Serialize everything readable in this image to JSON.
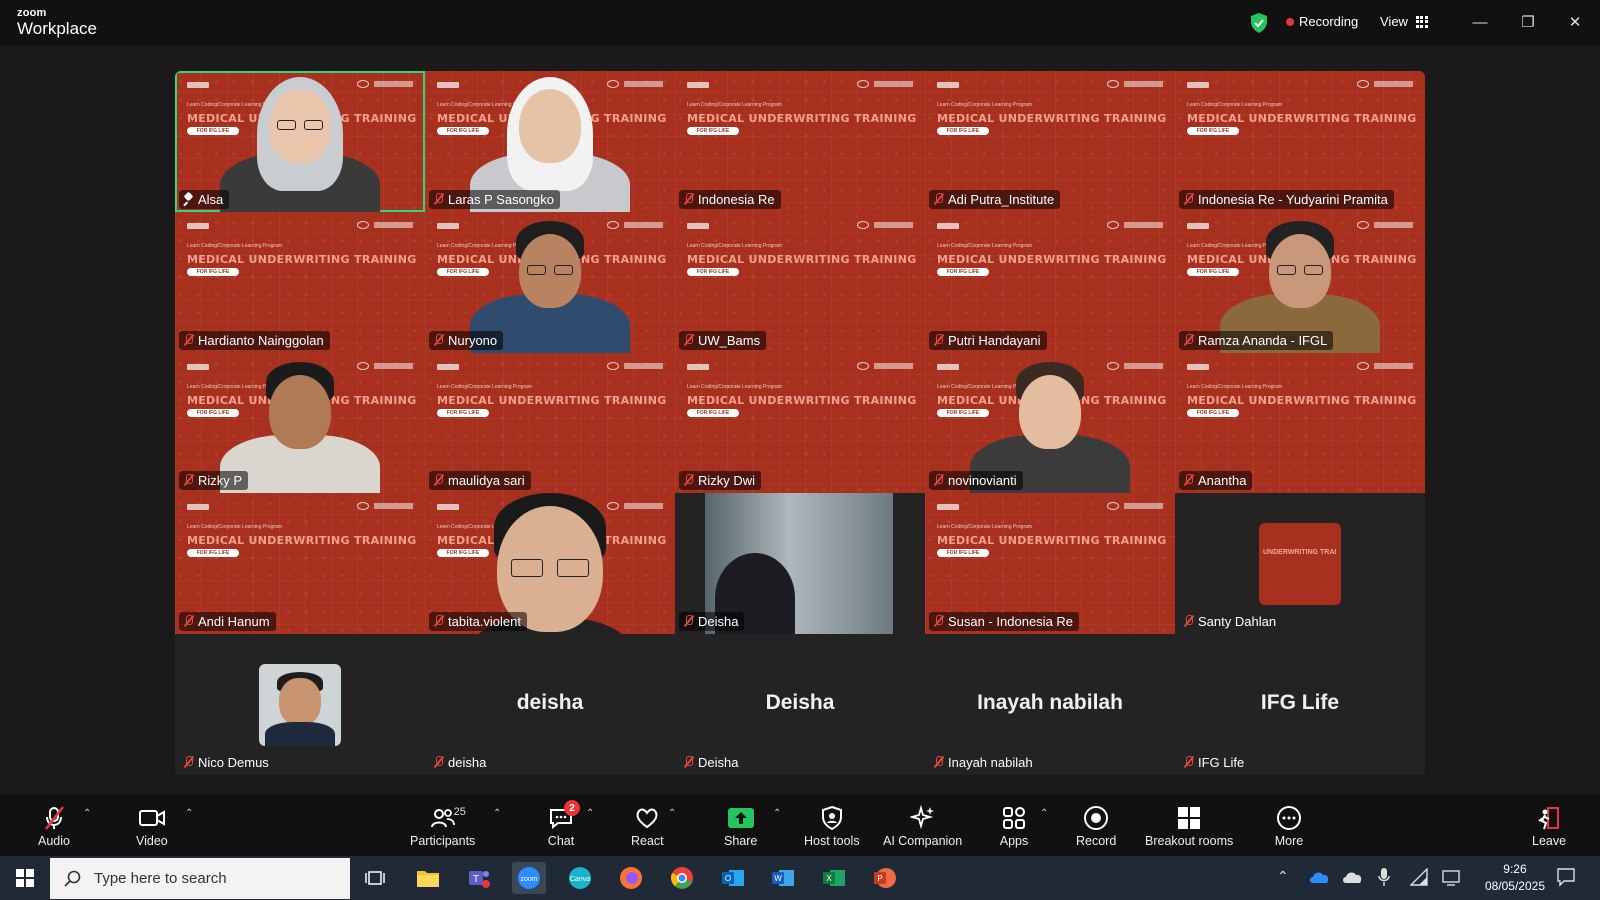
{
  "app": {
    "brand_top": "zoom",
    "brand_bottom": "Workplace"
  },
  "titlebar": {
    "recording_label": "Recording",
    "view_label": "View"
  },
  "tiles": [
    {
      "name": "Alsa",
      "kind": "slide-person",
      "icon": "pin-icon",
      "active": true
    },
    {
      "name": "Laras P Sasongko",
      "kind": "slide-person"
    },
    {
      "name": "Indonesia Re",
      "kind": "slide"
    },
    {
      "name": "Adi Putra_Institute",
      "kind": "slide"
    },
    {
      "name": "Indonesia Re - Yudyarini Pramita",
      "kind": "slide"
    },
    {
      "name": "Hardianto Nainggolan",
      "kind": "slide"
    },
    {
      "name": "Nuryono",
      "kind": "slide-person"
    },
    {
      "name": "UW_Bams",
      "kind": "slide"
    },
    {
      "name": "Putri Handayani",
      "kind": "slide"
    },
    {
      "name": "Ramza Ananda - IFGL",
      "kind": "slide-person"
    },
    {
      "name": "Rizky P",
      "kind": "slide-person"
    },
    {
      "name": "maulidya sari",
      "kind": "slide"
    },
    {
      "name": "Rizky Dwi",
      "kind": "slide"
    },
    {
      "name": "novinovianti",
      "kind": "slide-person"
    },
    {
      "name": "Anantha",
      "kind": "slide"
    },
    {
      "name": "Andi Hanum",
      "kind": "slide"
    },
    {
      "name": "tabita.violent",
      "kind": "slide-person"
    },
    {
      "name": "Deisha",
      "kind": "photo"
    },
    {
      "name": "Susan - Indonesia Re",
      "kind": "slide"
    },
    {
      "name": "Santy Dahlan",
      "kind": "mini-slide"
    },
    {
      "name": "Nico Demus",
      "kind": "avatar"
    },
    {
      "name": "deisha",
      "kind": "name-only",
      "display": "deisha"
    },
    {
      "name": "Deisha",
      "kind": "name-only",
      "display": "Deisha"
    },
    {
      "name": "Inayah nabilah",
      "kind": "name-only",
      "display": "Inayah nabilah"
    },
    {
      "name": "IFG Life",
      "kind": "name-only",
      "display": "IFG Life"
    }
  ],
  "slide": {
    "small_text": "Learn Coding/Corporate Learning Program",
    "title": "MEDICAL UNDERWRITING TRAINING",
    "pill": "FOR IFG LIFE",
    "mini_title": "UNDERWRITING TRAI"
  },
  "toolbar": {
    "audio": "Audio",
    "video": "Video",
    "participants": "Participants",
    "participants_count": "25",
    "chat": "Chat",
    "chat_badge": "2",
    "react": "React",
    "share": "Share",
    "host_tools": "Host tools",
    "ai_companion": "AI Companion",
    "apps": "Apps",
    "record": "Record",
    "breakout_rooms": "Breakout rooms",
    "more": "More",
    "leave": "Leave"
  },
  "taskbar": {
    "search_placeholder": "Type here to search",
    "time": "9:26",
    "date": "08/05/2025"
  },
  "colors": {
    "slide_red": "#a8301f",
    "active_border": "#2ed87a",
    "record_red": "#e8353b",
    "share_green": "#22c55e"
  }
}
